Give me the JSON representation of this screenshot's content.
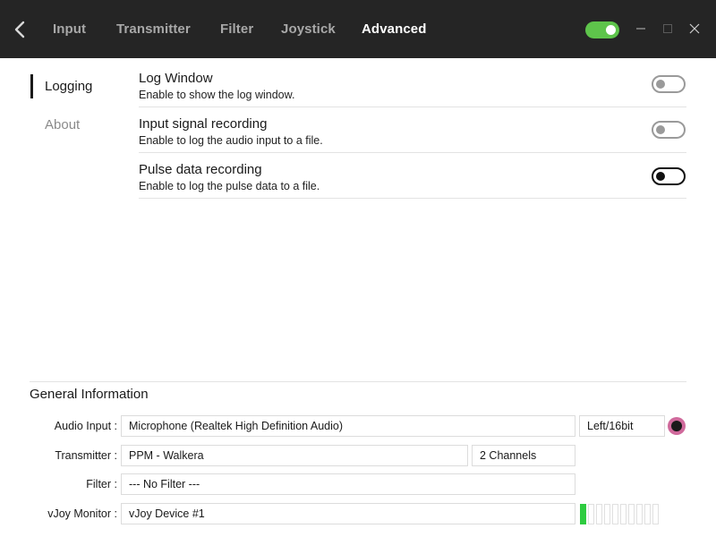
{
  "titlebar": {
    "tabs": [
      {
        "label": "Input",
        "active": false
      },
      {
        "label": "Transmitter",
        "active": false
      },
      {
        "label": "Filter",
        "active": false
      },
      {
        "label": "Joystick",
        "active": false
      },
      {
        "label": "Advanced",
        "active": true
      }
    ],
    "main_toggle_on": true,
    "accent_color": "#5ec44b"
  },
  "sidebar": {
    "items": [
      {
        "label": "Logging",
        "active": true
      },
      {
        "label": "About",
        "active": false
      }
    ]
  },
  "settings": [
    {
      "title": "Log Window",
      "description": "Enable to show the log window.",
      "enabled": false
    },
    {
      "title": "Input signal recording",
      "description": "Enable to log the audio input to a file.",
      "enabled": false
    },
    {
      "title": "Pulse data recording",
      "description": "Enable to log the pulse data to a file.",
      "enabled": false
    }
  ],
  "general_info": {
    "title": "General Information",
    "audio_input": {
      "label": "Audio Input :",
      "device": "Microphone (Realtek High Definition Audio)",
      "format": "Left/16bit"
    },
    "transmitter": {
      "label": "Transmitter :",
      "protocol": "PPM - Walkera",
      "channels": "2 Channels"
    },
    "filter": {
      "label": "Filter :",
      "value": "--- No Filter ---"
    },
    "vjoy": {
      "label": "vJoy Monitor :",
      "device": "vJoy Device #1",
      "meter_total": 10,
      "meter_active": 1
    },
    "record_color": "#d06a9c",
    "meter_color": "#2ecc40"
  }
}
